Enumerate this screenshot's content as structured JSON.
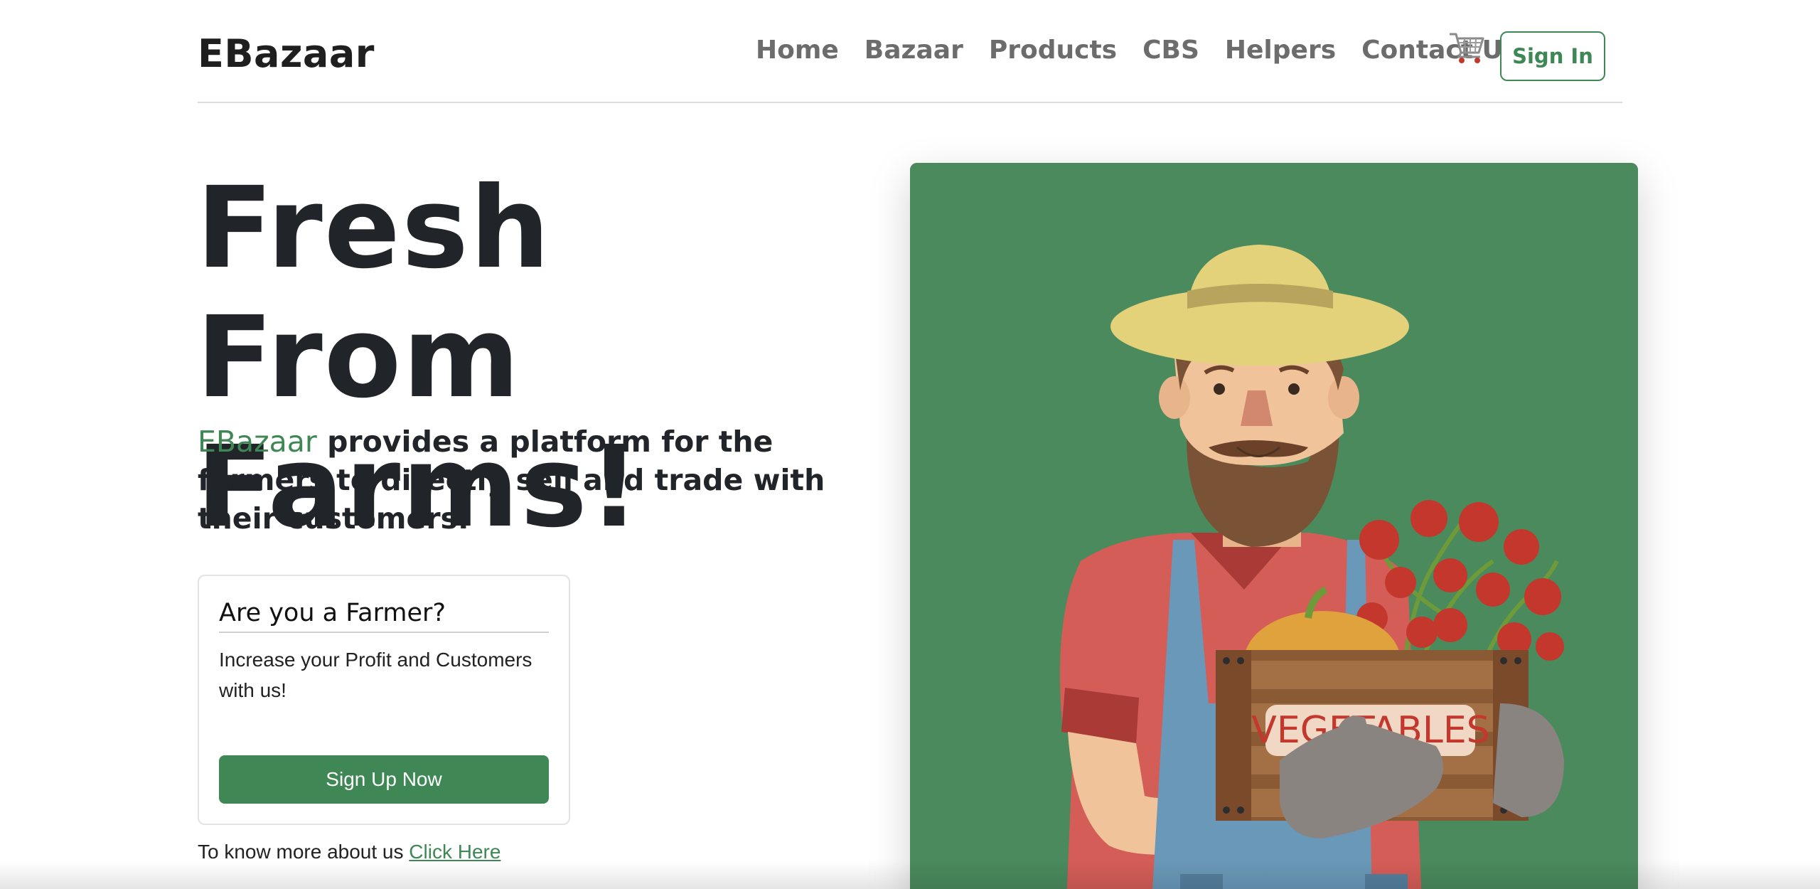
{
  "brand": {
    "name": "EBazaar"
  },
  "nav": {
    "links": [
      "Home",
      "Bazaar",
      "Products",
      "CBS",
      "Helpers",
      "Contact Us"
    ],
    "cart_icon": "shopping-cart-icon",
    "sign_in_label": "Sign In"
  },
  "hero": {
    "title_line1": "Fresh From",
    "title_line2": "Farms!",
    "subtitle_brand": "EBazaar",
    "subtitle_rest": " provides a platform for the farmers to directly sell and trade with their customers.",
    "image_label": "VEGETABLES"
  },
  "farmer_card": {
    "title": "Are you a Farmer?",
    "text": "Increase your Profit and Customers with us!",
    "button_label": "Sign Up Now"
  },
  "more_info": {
    "text": "To know more about us ",
    "link_label": "Click Here"
  },
  "colors": {
    "accent": "#3f8856",
    "image_bg": "#4a8a5c",
    "text_dark": "#212529",
    "nav_text": "#6c6c6c"
  }
}
